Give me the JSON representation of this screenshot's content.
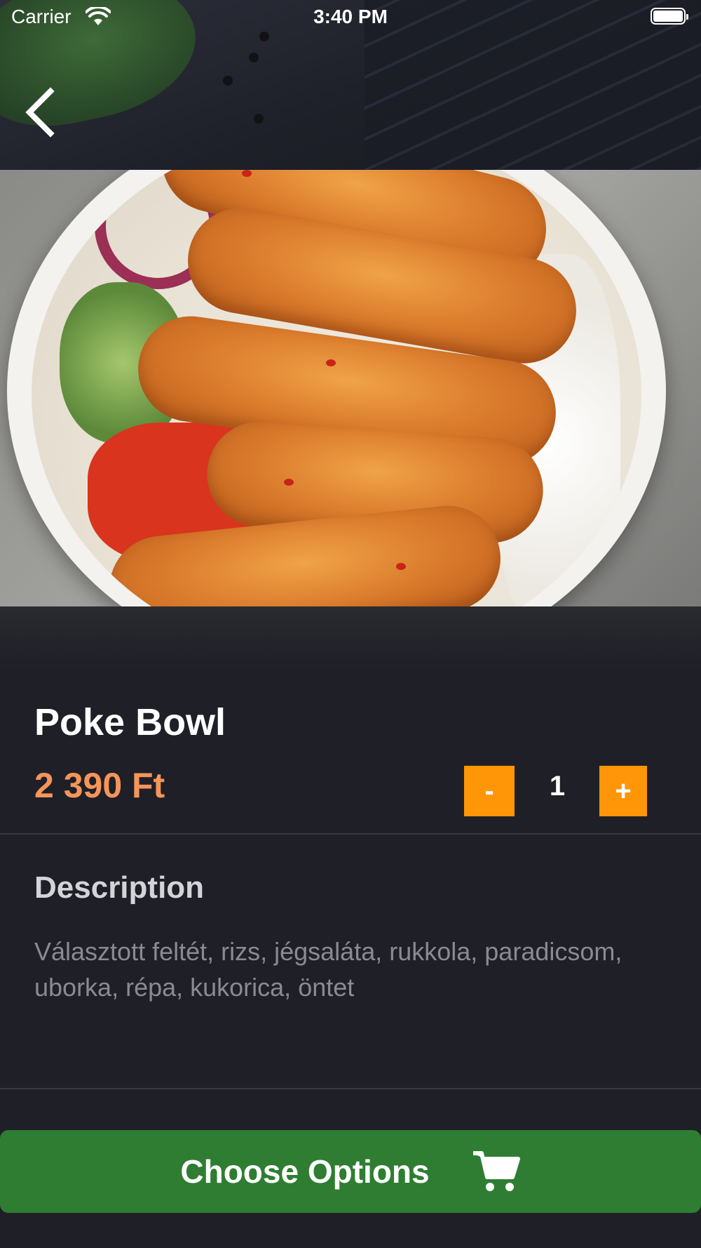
{
  "status_bar": {
    "carrier": "Carrier",
    "time": "3:40 PM"
  },
  "product": {
    "title": "Poke Bowl",
    "price": "2 390 Ft",
    "quantity": "1",
    "minus_label": "-",
    "plus_label": "+"
  },
  "description": {
    "heading": "Description",
    "text": "Választott feltét, rizs, jégsaláta, rukkola, paradicsom, uborka, répa, kukorica, öntet"
  },
  "actions": {
    "choose_options_label": "Choose Options"
  },
  "icons": {
    "back": "chevron-left-icon",
    "cart": "shopping-cart-icon",
    "wifi": "wifi-icon",
    "battery": "battery-icon"
  },
  "colors": {
    "background": "#1f2027",
    "price": "#f5955a",
    "quantity_buttons": "#ff9608",
    "primary_button": "#2f7d32"
  }
}
